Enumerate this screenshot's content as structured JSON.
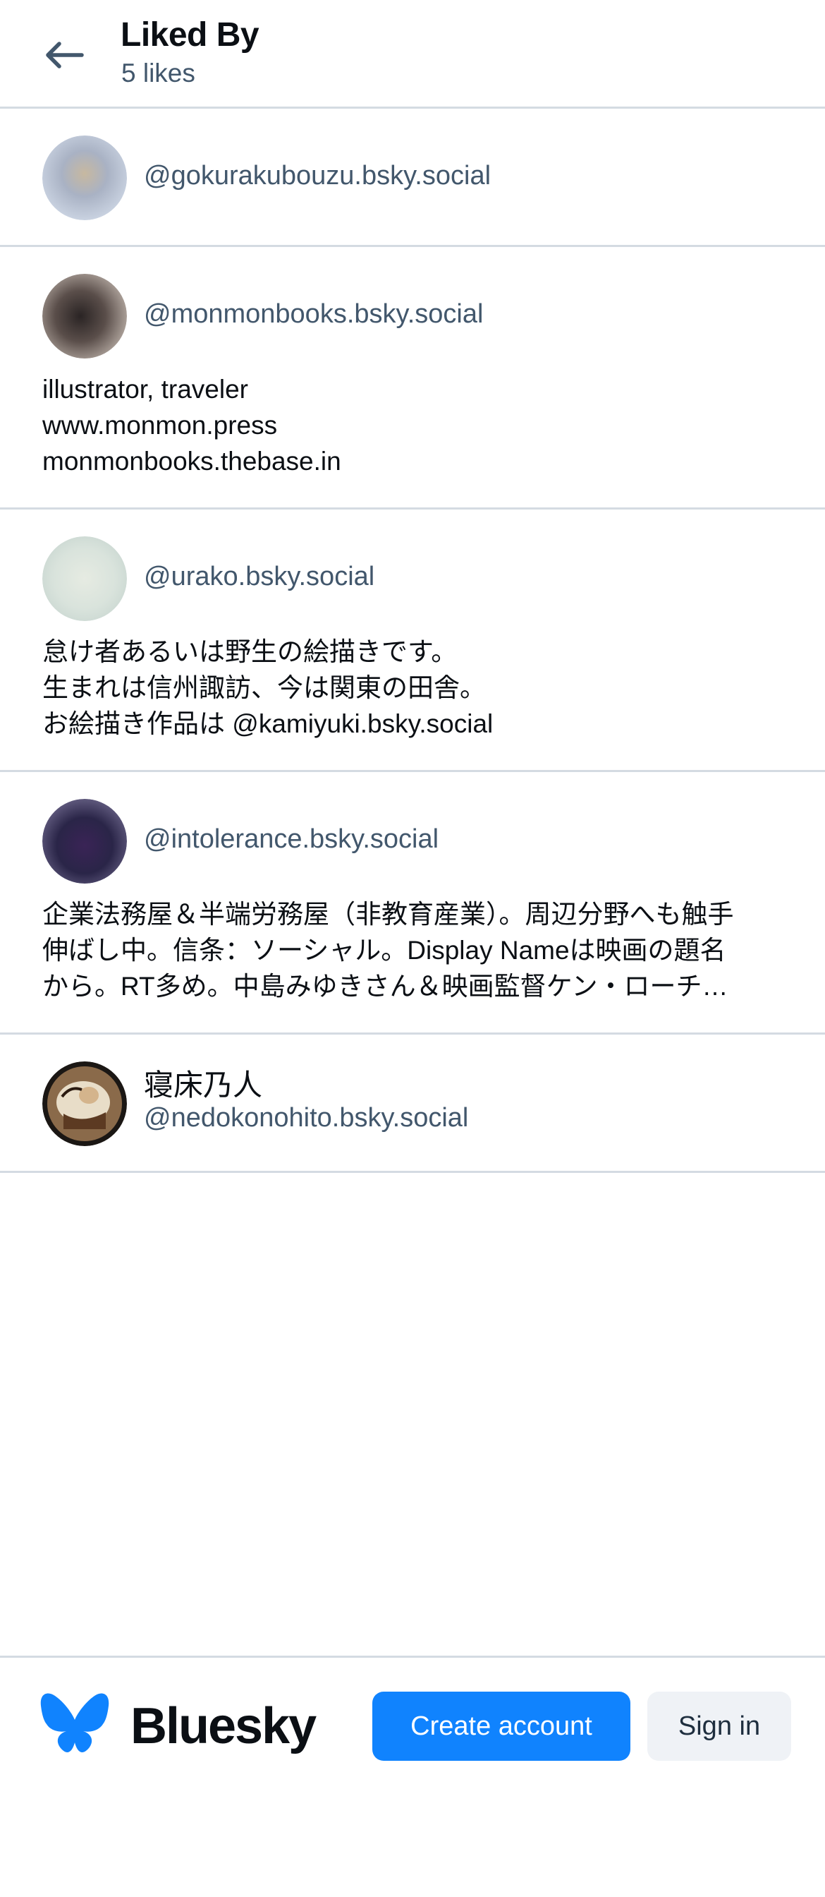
{
  "header": {
    "title": "Liked By",
    "subtitle": "5 likes",
    "back_icon": "arrow-left-icon"
  },
  "likers": [
    {
      "display_name": "",
      "handle": "@gokurakubouzu.bsky.social",
      "bio": []
    },
    {
      "display_name": "",
      "handle": "@monmonbooks.bsky.social",
      "bio": [
        "illustrator, traveler",
        "www.monmon.press",
        "monmonbooks.thebase.in"
      ]
    },
    {
      "display_name": "",
      "handle": "@urako.bsky.social",
      "bio": [
        "怠け者あるいは野生の絵描きです。",
        "生まれは信州諏訪、今は関東の田舎。",
        "お絵描き作品は @kamiyuki.bsky.social"
      ]
    },
    {
      "display_name": "",
      "handle": "@intolerance.bsky.social",
      "bio": [
        "企業法務屋＆半端労務屋（非教育産業）。周辺分野へも触手",
        "伸ばし中。信条：ソーシャル。Display Nameは映画の題名",
        "から。RT多め。中島みゆきさん＆映画監督ケン・ローチ…"
      ]
    },
    {
      "display_name": "寝床乃人",
      "handle": "@nedokonohito.bsky.social",
      "bio": []
    }
  ],
  "footer": {
    "brand": "Bluesky",
    "logo_icon": "butterfly-icon",
    "create_account_label": "Create account",
    "sign_in_label": "Sign in"
  },
  "colors": {
    "accent": "#1083fe",
    "muted_text": "#42576c",
    "divider": "#d4dbe2"
  }
}
